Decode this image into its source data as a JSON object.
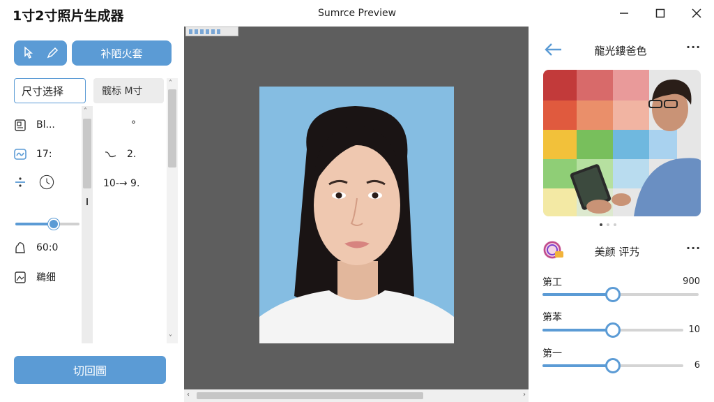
{
  "app": {
    "title": "1寸2寸照片生成器",
    "preview_title": "Sumrce Preview"
  },
  "left": {
    "primary_tab": "补陋火套",
    "size_tab": "尺寸选择",
    "secondary_tab": "髋标 M寸",
    "items": [
      {
        "icon": "id-card-icon",
        "label": "Bl..."
      },
      {
        "icon": "wave-icon",
        "label": "17:"
      },
      {
        "icon": "divide-icon",
        "label": ""
      },
      {
        "icon": "person-outline-icon",
        "label": "60:0"
      },
      {
        "icon": "photo-frame-icon",
        "label": "鵜细"
      }
    ],
    "right_items": [
      {
        "label": "°"
      },
      {
        "icon": "curve-icon",
        "label": "2."
      },
      {
        "label": "10-→ 9."
      }
    ],
    "mini_slider_value": 0.6,
    "bottom_button": "切回圖"
  },
  "right": {
    "header_title": "龍光鏤爸色",
    "beauty_title": "美颜 评艿",
    "sliders": [
      {
        "label": "第工",
        "value": "900",
        "fraction": 0.45
      },
      {
        "label": "第苯",
        "value": "10",
        "fraction": 0.45
      },
      {
        "label": "第一",
        "value": "6",
        "fraction": 0.45
      }
    ],
    "carousel_dots": 3,
    "carousel_active": 0
  },
  "colors": {
    "accent": "#5b9bd5",
    "canvas_bg": "#5e5e5e",
    "photo_bg": "#85bde2"
  }
}
